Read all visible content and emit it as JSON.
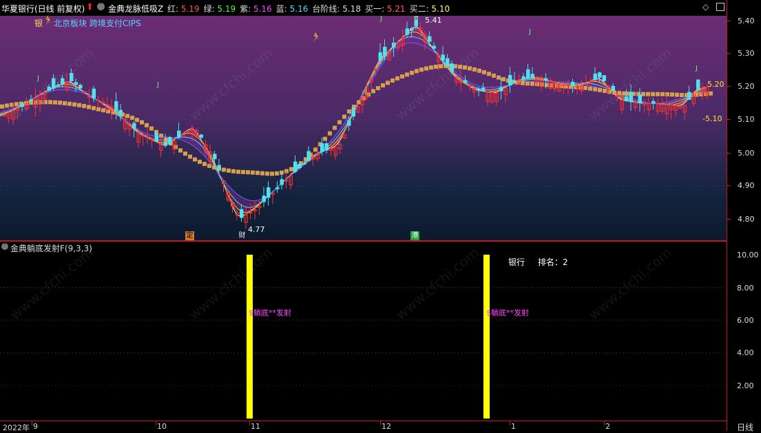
{
  "header": {
    "stock_title": "华夏银行(日线 前复权)",
    "indicator_name": "金典龙脉低吸Z",
    "values": [
      {
        "label": "红:",
        "value": "5.19",
        "color": "#ff5050"
      },
      {
        "label": "绿:",
        "value": "5.19",
        "color": "#40ff40"
      },
      {
        "label": "紫:",
        "value": "5.16",
        "color": "#ff40ff"
      },
      {
        "label": "蓝:",
        "value": "5.16",
        "color": "#40e0ff"
      },
      {
        "label": "台阶线:",
        "value": "5.18",
        "color": "#dddddd"
      },
      {
        "label": "买一:",
        "value": "5.21",
        "color": "#ff6060"
      },
      {
        "label": "买二:",
        "value": "5.10",
        "color": "#ffff60"
      }
    ]
  },
  "main_chart": {
    "sector_tags": "北京板块 跨境支付CIPS",
    "sector_prefix": "银",
    "high_label": "5.41",
    "low_label": "4.77",
    "right_marker_top": "5.20",
    "right_marker_bottom": "-5.10",
    "event_badges": [
      "定",
      "财",
      "港"
    ],
    "j_marker": "J"
  },
  "lower_chart": {
    "indicator_title": "金典躺底发射F(9,3,3)",
    "signal_label_1": "$躺底**发射",
    "signal_label_2": "$躺底**发射",
    "rank_label": "银行",
    "rank_value": "排名：2"
  },
  "axis": {
    "price_ticks": [
      "5.40",
      "5.30",
      "5.20",
      "5.10",
      "5.00",
      "4.90",
      "4.80"
    ],
    "lower_ticks": [
      "10.00",
      "8.00",
      "6.00",
      "4.00",
      "2.00"
    ],
    "bottom_right_label": "日线",
    "date_labels": [
      "2022年",
      "9",
      "10",
      "11",
      "12",
      "1",
      "2"
    ]
  },
  "watermark": "www.cfchi.com",
  "chart_data": [
    {
      "type": "candlestick",
      "title": "华夏银行(日线 前复权)",
      "ylim": [
        4.75,
        5.45
      ],
      "note_high": 5.41,
      "note_low": 4.77,
      "step_line_last": 5.18
    },
    {
      "type": "bar",
      "title": "金典躺底发射F(9,3,3)",
      "ylim": [
        0,
        10.5
      ],
      "categories": [
        "11月初",
        "12月底"
      ],
      "values": [
        10,
        10
      ]
    }
  ]
}
